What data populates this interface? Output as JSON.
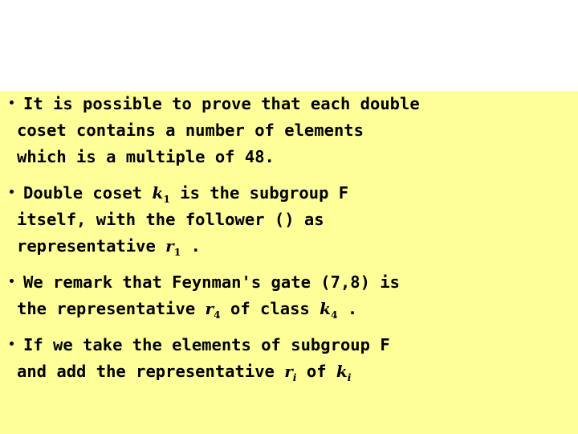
{
  "slide": {
    "background_top_color": "#ffffff",
    "background_body_color": "#ffff99",
    "text_color": "#000000",
    "bullet_glyph": "bullet-dot"
  },
  "bullets": [
    {
      "id": "bullet-1",
      "lines": [
        {
          "segments": [
            {
              "type": "text",
              "text": "It is possible to prove that each double"
            }
          ]
        },
        {
          "segments": [
            {
              "type": "text",
              "text": "coset contains a number of elements"
            }
          ]
        },
        {
          "segments": [
            {
              "type": "text",
              "text": "which is a multiple of 48."
            }
          ]
        }
      ]
    },
    {
      "id": "bullet-2",
      "lines": [
        {
          "segments": [
            {
              "type": "text",
              "text": "Double coset "
            },
            {
              "type": "var",
              "base": "k",
              "sub": "1",
              "sub_italic": false
            },
            {
              "type": "text",
              "text": " is the subgroup F"
            }
          ]
        },
        {
          "segments": [
            {
              "type": "text",
              "text": "itself, with the follower () as"
            }
          ]
        },
        {
          "segments": [
            {
              "type": "text",
              "text": "representative "
            },
            {
              "type": "var",
              "base": "r",
              "sub": "1",
              "sub_italic": false
            },
            {
              "type": "text",
              "text": " ."
            }
          ]
        }
      ]
    },
    {
      "id": "bullet-3",
      "lines": [
        {
          "segments": [
            {
              "type": "text",
              "text": "We remark that Feynman's gate (7,8) is"
            }
          ]
        },
        {
          "segments": [
            {
              "type": "text",
              "text": "the representative "
            },
            {
              "type": "var",
              "base": "r",
              "sub": "4",
              "sub_italic": false
            },
            {
              "type": "text",
              "text": " of class "
            },
            {
              "type": "var",
              "base": "k",
              "sub": "4",
              "sub_italic": false
            },
            {
              "type": "text",
              "text": " ."
            }
          ]
        }
      ]
    },
    {
      "id": "bullet-4",
      "lines": [
        {
          "segments": [
            {
              "type": "text",
              "text": "If we take the elements of subgroup F"
            }
          ]
        },
        {
          "segments": [
            {
              "type": "text",
              "text": "and add the representative "
            },
            {
              "type": "var",
              "base": "r",
              "sub": "i",
              "sub_italic": true
            },
            {
              "type": "text",
              "text": " of "
            },
            {
              "type": "var",
              "base": "k",
              "sub": "i",
              "sub_italic": true
            }
          ]
        }
      ]
    }
  ]
}
